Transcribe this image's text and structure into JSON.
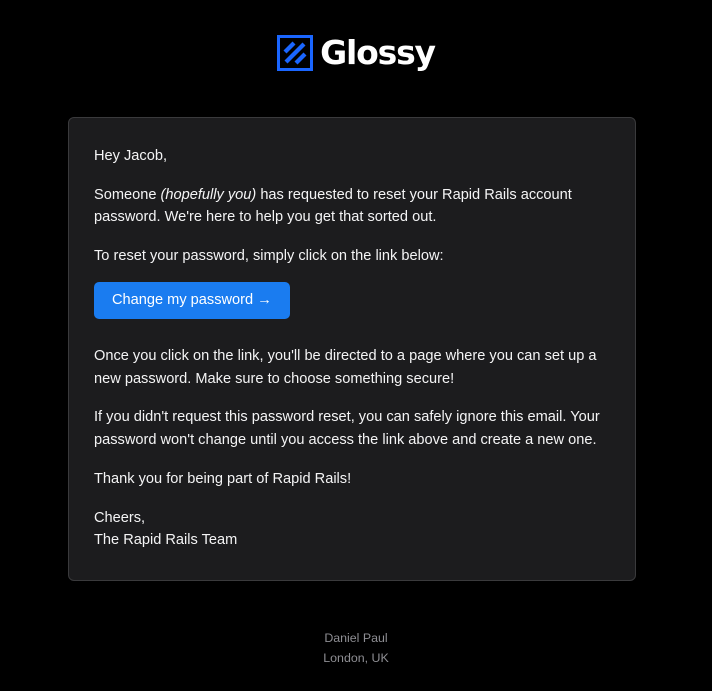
{
  "brand": {
    "name": "Glossy",
    "logo_icon": "glossy-logo-icon",
    "accent_color": "#1a66ff"
  },
  "email": {
    "greeting": "Hey Jacob,",
    "intro_before": "Someone ",
    "intro_emphasis": "(hopefully you)",
    "intro_after": " has requested to reset your Rapid Rails account password. We're here to help you get that sorted out.",
    "instruction": "To reset your password, simply click on the link below:",
    "cta_label": "Change my password →",
    "after_click": "Once you click on the link, you'll be directed to a page where you can set up a new password. Make sure to choose something secure!",
    "ignore_note": "If you didn't request this password reset, you can safely ignore this email. Your password won't change until you access the link above and create a new one.",
    "thanks": "Thank you for being part of Rapid Rails!",
    "signoff": "Cheers,",
    "signature": "The Rapid Rails Team"
  },
  "footer": {
    "name": "Daniel Paul",
    "location": "London, UK"
  },
  "colors": {
    "background": "#000000",
    "card": "#1c1c1e",
    "card_border": "#3a3a3c",
    "button": "#1a7cf0",
    "footer_text": "#8e8e93"
  }
}
